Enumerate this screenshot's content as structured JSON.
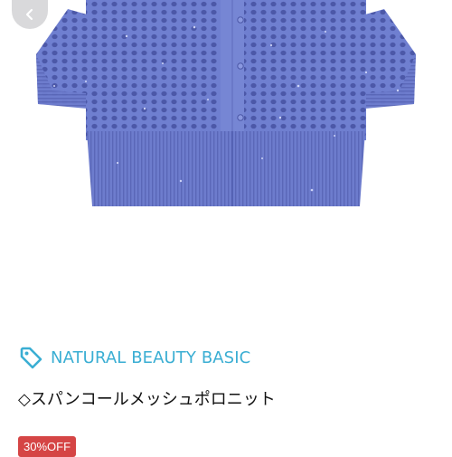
{
  "product": {
    "brand": "NATURAL BEAUTY BASIC",
    "title": "◇スパンコールメッシュポロニット",
    "discount": "30%OFF"
  },
  "icons": {
    "back": "chevron-left-icon",
    "brand_tag": "tag-icon"
  },
  "colors": {
    "brand": "#3aaed3",
    "discount_badge": "#d54545",
    "knit": "#6f7fd0"
  }
}
